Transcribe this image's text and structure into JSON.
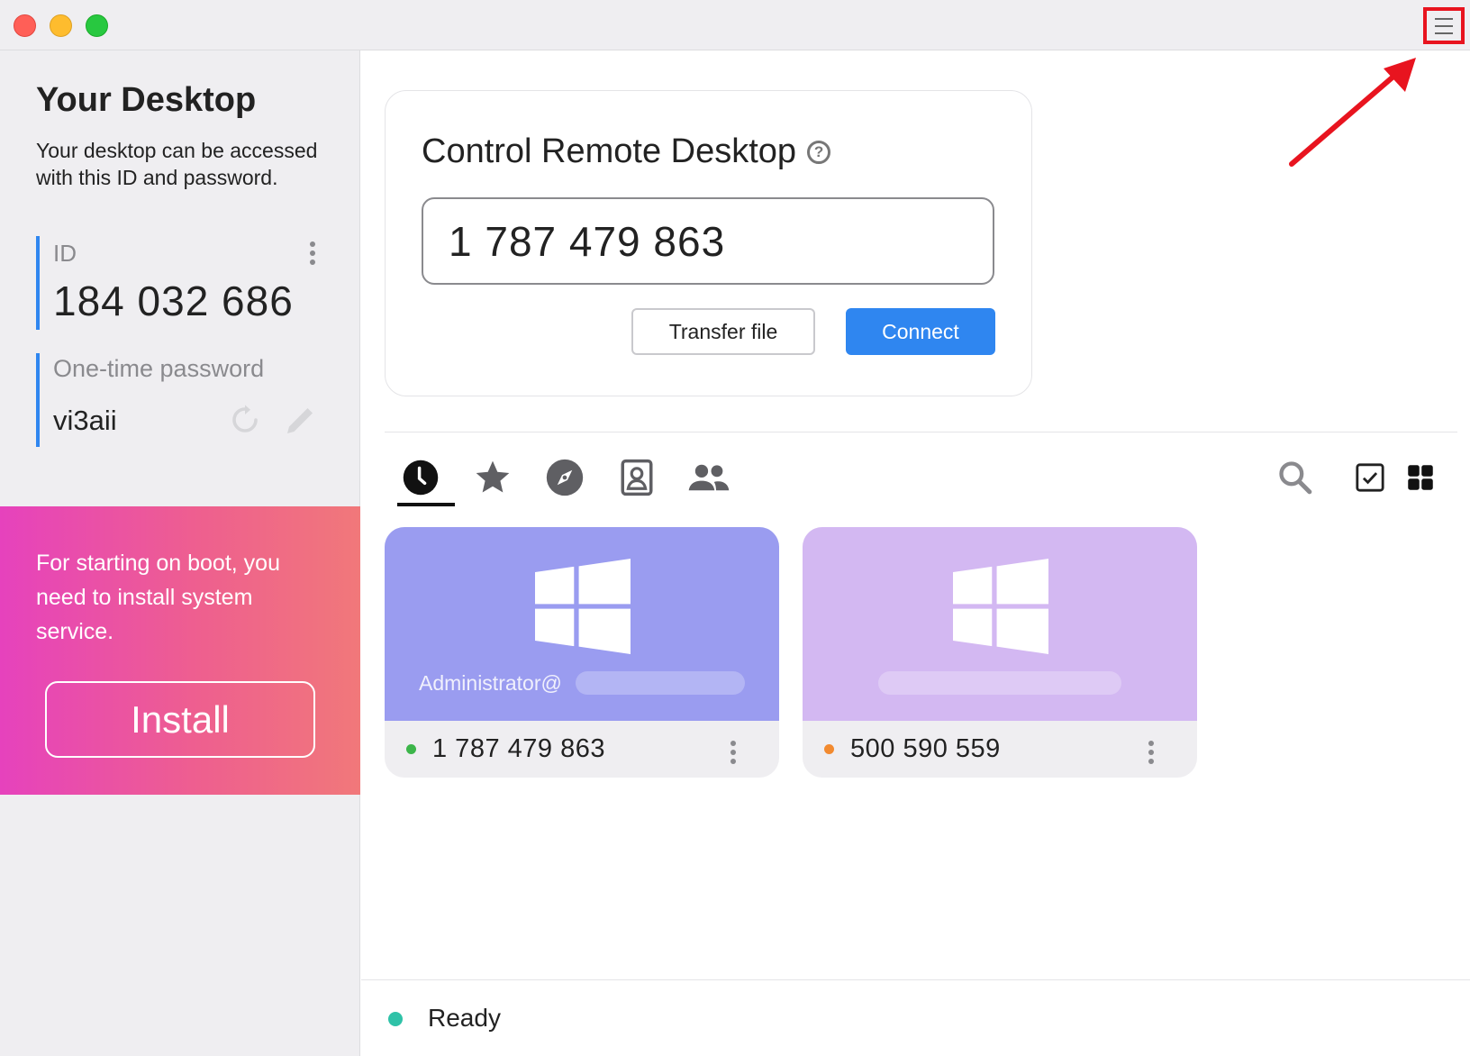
{
  "window": {
    "accent_color": "#2f86f0",
    "highlight_color": "#e8141f"
  },
  "sidebar": {
    "title": "Your Desktop",
    "description": "Your desktop can be accessed with this ID and password.",
    "id_label": "ID",
    "id_value": "184 032 686",
    "password_label": "One-time password",
    "password_value": "vi3aii",
    "install_panel": {
      "message": "For starting on boot, you need to install system service.",
      "button_label": "Install"
    }
  },
  "connect": {
    "title": "Control Remote Desktop",
    "help_glyph": "?",
    "id_input_value": "1 787 479 863",
    "transfer_label": "Transfer file",
    "connect_label": "Connect"
  },
  "tabs": [
    {
      "icon": "clock-icon",
      "name": "recent"
    },
    {
      "icon": "star-icon",
      "name": "favorites"
    },
    {
      "icon": "compass-icon",
      "name": "discovered"
    },
    {
      "icon": "address-book-icon",
      "name": "address-book"
    },
    {
      "icon": "group-icon",
      "name": "group"
    }
  ],
  "toolbar_icons": [
    "search-icon",
    "checkbox-icon",
    "grid-view-icon"
  ],
  "peers": [
    {
      "user": "Administrator@",
      "id": "1 787 479 863",
      "status_color": "#3cb54a",
      "tile_color": "#9a9cf0",
      "os_icon": "windows-logo-icon"
    },
    {
      "user": "",
      "id": "500 590 559",
      "status_color": "#f28a30",
      "tile_color": "#d3b8f2",
      "os_icon": "windows-logo-icon"
    }
  ],
  "status": {
    "text": "Ready",
    "color": "#2fc2a8"
  }
}
